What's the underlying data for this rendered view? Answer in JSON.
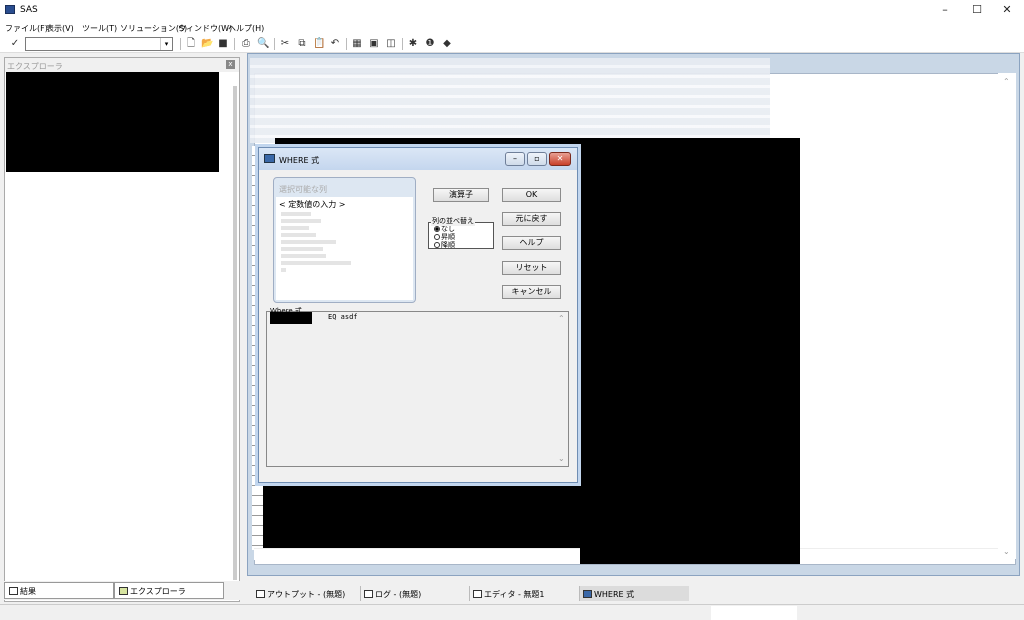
{
  "window": {
    "title": "SAS",
    "minimize": "–",
    "maximize": "☐",
    "close": "✕"
  },
  "menu": [
    "ファイル(F)",
    "表示(V)",
    "ツール(T)",
    "ソリューション(S)",
    "ウィンドウ(W)",
    "ヘルプ(H)"
  ],
  "toolbar": {
    "check": "✓",
    "command_value": "",
    "icons": [
      "new-icon",
      "open-icon",
      "save-icon",
      "print-icon",
      "print-preview-icon",
      "cut-icon",
      "copy-icon",
      "paste-icon",
      "undo-icon",
      "libraries-icon",
      "explorer-icon",
      "results-icon",
      "run-icon",
      "help-icon",
      "book-icon"
    ]
  },
  "explorer": {
    "title": "エクスプローラ",
    "close": "x"
  },
  "left_tabs": [
    {
      "label": "結果"
    },
    {
      "label": "エクスプローラ"
    }
  ],
  "dialog": {
    "title": "WHERE 式",
    "available_columns_label": "選択可能な列",
    "first_item": "< 定数値の入力 >",
    "operators_button": "演算子",
    "ok_button": "OK",
    "undo_button": "元に戻す",
    "help_button": "ヘルプ",
    "reset_button": "リセット",
    "cancel_button": "キャンセル",
    "sort_label": "列の並べ替え",
    "sort_options": [
      "なし",
      "昇順",
      "降順"
    ],
    "sort_selected": "なし",
    "where_label": "Where 式",
    "where_text": "EQ asdf"
  },
  "window_tabs": [
    {
      "label": "アウトプット - (無題)",
      "icon": "output-icon"
    },
    {
      "label": "ログ - (無題)",
      "icon": "log-icon"
    },
    {
      "label": "エディタ - 無題1",
      "icon": "editor-icon"
    },
    {
      "label": "WHERE 式",
      "icon": "where-icon",
      "active": true
    }
  ]
}
